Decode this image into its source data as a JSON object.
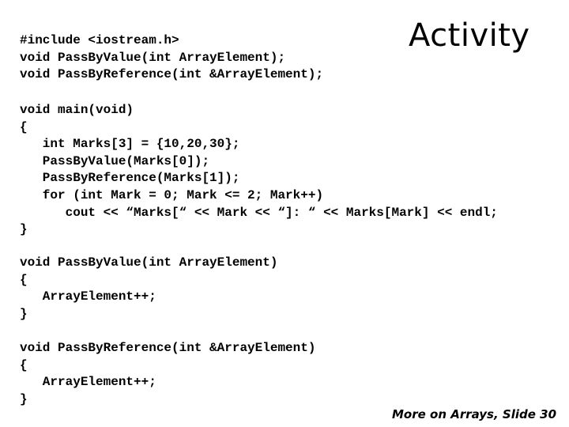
{
  "slide": {
    "title": "Activity",
    "footer": "More on Arrays, Slide 30",
    "code_blocks": {
      "includes": [
        "#include <iostream.h>",
        "void PassByValue(int ArrayElement);",
        "void PassByReference(int &ArrayElement);"
      ],
      "main": [
        "void main(void)",
        "{",
        "   int Marks[3] = {10,20,30};",
        "   PassByValue(Marks[0]);",
        "   PassByReference(Marks[1]);",
        "   for (int Mark = 0; Mark <= 2; Mark++)",
        "      cout << “Marks[“ << Mark << “]: “ << Marks[Mark] << endl;",
        "}"
      ],
      "by_value": [
        "void PassByValue(int ArrayElement)",
        "{",
        "   ArrayElement++;",
        "}"
      ],
      "by_reference": [
        "void PassByReference(int &ArrayElement)",
        "{",
        "   ArrayElement++;",
        "}"
      ]
    }
  }
}
